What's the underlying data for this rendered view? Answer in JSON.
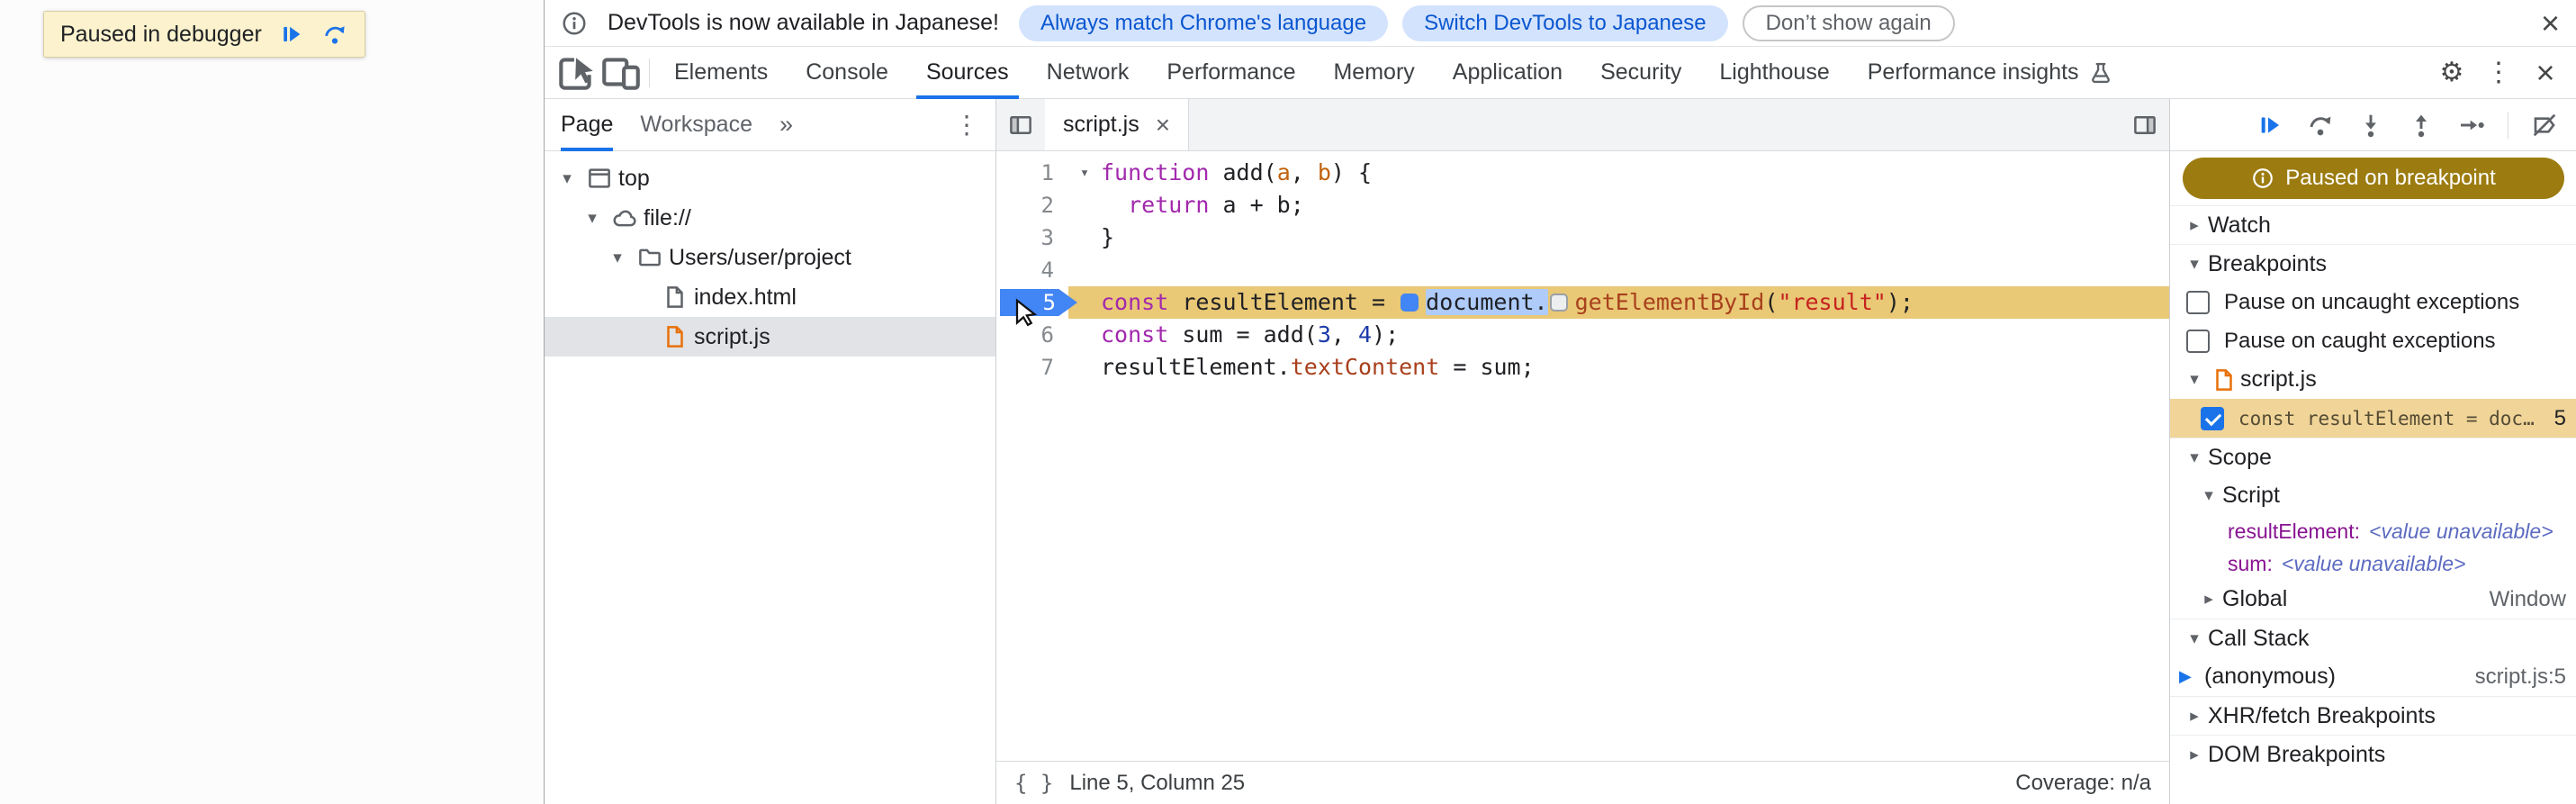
{
  "colors": {
    "accent_blue": "#1a73e8",
    "paused_pill_bg": "#9c7c10",
    "paused_line_bg": "#e9c876",
    "breakpoint_row_bg": "#f0d498",
    "token_selection_bg": "#aecbfa",
    "syntax": {
      "keyword": "#a229ad",
      "string": "#c5221f",
      "number": "#1c3aa9",
      "property": "#a8401c",
      "parameter": "#c2610c",
      "scope_var_name": "#881391",
      "value_unavailable": "#5c6bc0"
    }
  },
  "page": {
    "paused_banner": {
      "label": "Paused in debugger",
      "icons": [
        "resume-icon",
        "step-over-icon"
      ]
    }
  },
  "infobar": {
    "icon": "info-icon",
    "message": "DevTools is now available in Japanese!",
    "buttons": [
      {
        "label": "Always match Chrome's language",
        "style": "tonal"
      },
      {
        "label": "Switch DevTools to Japanese",
        "style": "tonal"
      },
      {
        "label": "Don’t show again",
        "style": "outline"
      }
    ],
    "close_icon": "close-icon"
  },
  "tabbar": {
    "left_icons": [
      "inspect-icon",
      "device-toolbar-icon"
    ],
    "tabs": [
      {
        "label": "Elements"
      },
      {
        "label": "Console"
      },
      {
        "label": "Sources",
        "selected": true
      },
      {
        "label": "Network"
      },
      {
        "label": "Performance"
      },
      {
        "label": "Memory"
      },
      {
        "label": "Application"
      },
      {
        "label": "Security"
      },
      {
        "label": "Lighthouse"
      },
      {
        "label": "Performance insights",
        "flask": true
      }
    ],
    "right_icons": [
      "settings-gear-icon",
      "more-menu-icon",
      "close-icon"
    ]
  },
  "navigator": {
    "tabs": [
      {
        "label": "Page",
        "selected": true
      },
      {
        "label": "Workspace"
      }
    ],
    "overflow_icon": "chevron-double-right-icon",
    "more_icon": "kebab-menu-icon",
    "tree": [
      {
        "label": "top",
        "icon": "frame-icon",
        "depth": 0,
        "expanded": true
      },
      {
        "label": "file://",
        "icon": "cloud-icon",
        "depth": 1,
        "expanded": true
      },
      {
        "label": "Users/user/project",
        "icon": "folder-icon",
        "depth": 2,
        "expanded": true
      },
      {
        "label": "index.html",
        "icon": "document-icon",
        "depth": 3
      },
      {
        "label": "script.js",
        "icon": "document-js-icon",
        "depth": 3,
        "selected": true
      }
    ]
  },
  "editor": {
    "tab": {
      "label": "script.js",
      "close_icon": "close-icon"
    },
    "lines": [
      {
        "num": 1,
        "fold": true,
        "tokens": [
          {
            "c": "kw",
            "s": "function"
          },
          {
            "c": "pl",
            "s": " add("
          },
          {
            "c": "pr",
            "s": "a"
          },
          {
            "c": "pl",
            "s": ", "
          },
          {
            "c": "pr",
            "s": "b"
          },
          {
            "c": "pl",
            "s": ") {"
          }
        ]
      },
      {
        "num": 2,
        "tokens": [
          {
            "c": "pl",
            "s": "  "
          },
          {
            "c": "kw",
            "s": "return"
          },
          {
            "c": "pl",
            "s": " a + b;"
          }
        ]
      },
      {
        "num": 3,
        "tokens": [
          {
            "c": "pl",
            "s": "}"
          }
        ]
      },
      {
        "num": 4,
        "tokens": []
      },
      {
        "num": 5,
        "paused": true,
        "breakpoint": true,
        "tokens": [
          {
            "c": "kw",
            "s": "const"
          },
          {
            "c": "pl",
            "s": " resultElement = "
          },
          {
            "c": "bpA",
            "s": ""
          },
          {
            "c": "sel",
            "s": "document."
          },
          {
            "c": "bpC",
            "s": ""
          },
          {
            "c": "prop",
            "s": "getElementById"
          },
          {
            "c": "pl",
            "s": "("
          },
          {
            "c": "st",
            "s": "\"result\""
          },
          {
            "c": "pl",
            "s": ");"
          }
        ]
      },
      {
        "num": 6,
        "tokens": [
          {
            "c": "kw",
            "s": "const"
          },
          {
            "c": "pl",
            "s": " sum = add("
          },
          {
            "c": "nu",
            "s": "3"
          },
          {
            "c": "pl",
            "s": ", "
          },
          {
            "c": "nu",
            "s": "4"
          },
          {
            "c": "pl",
            "s": ");"
          }
        ]
      },
      {
        "num": 7,
        "tokens": [
          {
            "c": "pl",
            "s": "resultElement."
          },
          {
            "c": "prop",
            "s": "textContent"
          },
          {
            "c": "pl",
            "s": " = sum;"
          }
        ]
      }
    ],
    "status": {
      "line_col": "Line 5, Column 25",
      "coverage": "Coverage: n/a"
    }
  },
  "debugger": {
    "controls": [
      {
        "name": "resume-button",
        "icon": "resume-icon",
        "primary": true
      },
      {
        "name": "step-over-button",
        "icon": "step-over-icon"
      },
      {
        "name": "step-into-button",
        "icon": "step-into-icon"
      },
      {
        "name": "step-out-button",
        "icon": "step-out-icon"
      },
      {
        "name": "step-button",
        "icon": "step-icon"
      },
      {
        "name": "deactivate-breakpoints-button",
        "icon": "deactivate-breakpoints-icon"
      }
    ],
    "paused_message": "Paused on breakpoint",
    "watch": {
      "label": "Watch"
    },
    "breakpoints": {
      "label": "Breakpoints",
      "pause_uncaught": "Pause on uncaught exceptions",
      "pause_caught": "Pause on caught exceptions",
      "file_group": {
        "file": "script.js",
        "entries": [
          {
            "checked": true,
            "snippet": "const resultElement = doc…",
            "line": "5"
          }
        ]
      }
    },
    "scope": {
      "label": "Scope",
      "script_group": {
        "label": "Script",
        "variables": [
          {
            "name": "resultElement:",
            "value": "<value unavailable>"
          },
          {
            "name": "sum:",
            "value": "<value unavailable>"
          }
        ]
      },
      "global_group": {
        "label": "Global",
        "value": "Window"
      }
    },
    "call_stack": {
      "label": "Call Stack",
      "frames": [
        {
          "name": "(anonymous)",
          "location": "script.js:5",
          "active": true
        }
      ]
    },
    "xhr_breakpoints": {
      "label": "XHR/fetch Breakpoints"
    },
    "dom_breakpoints": {
      "label": "DOM Breakpoints"
    }
  }
}
